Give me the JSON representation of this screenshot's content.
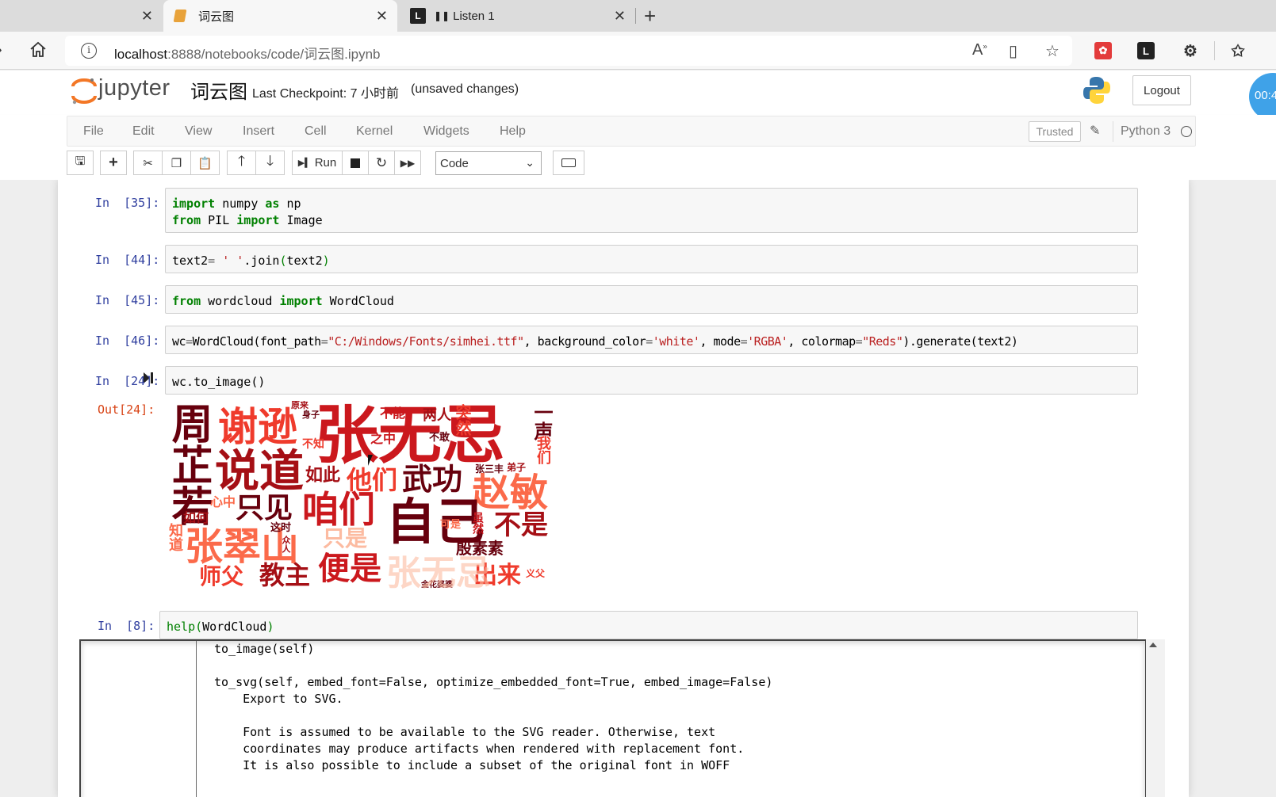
{
  "browser": {
    "tabs": [
      {
        "label": ""
      },
      {
        "label": "词云图"
      },
      {
        "label": "Listen 1"
      }
    ],
    "url_host": "localhost",
    "url_path": ":8888/notebooks/code/词云图.ipynb"
  },
  "jupyter": {
    "logo_text": "jupyter",
    "notebook_title": "词云图",
    "checkpoint": "Last Checkpoint: 7 小时前",
    "unsaved": "(unsaved changes)",
    "logout": "Logout",
    "timer": "00:4"
  },
  "menu": [
    "File",
    "Edit",
    "View",
    "Insert",
    "Cell",
    "Kernel",
    "Widgets",
    "Help"
  ],
  "kernel": {
    "trusted": "Trusted",
    "name": "Python 3"
  },
  "toolbar": {
    "run_label": "Run",
    "cell_type": "Code"
  },
  "cells": [
    {
      "prompt": "In  [35]:",
      "lines": [
        "import numpy as np",
        "from PIL import Image"
      ]
    },
    {
      "prompt": "In  [44]:",
      "lines": [
        "text2= ' '.join(text2)"
      ]
    },
    {
      "prompt": "In  [45]:",
      "lines": [
        "from wordcloud import WordCloud"
      ]
    },
    {
      "prompt": "In  [46]:",
      "lines": [
        "wc=WordCloud(font_path=\"C:/Windows/Fonts/simhei.ttf\", background_color='white', mode='RGBA', colormap=\"Reds\").generate(text2)"
      ]
    },
    {
      "prompt": "In  [24]:",
      "lines": [
        "wc.to_image()"
      ]
    },
    {
      "prompt": "In  [8]:",
      "lines": [
        "help(WordCloud)"
      ]
    }
  ],
  "output_prompt": "Out[24]:",
  "wordcloud": {
    "words": [
      "张无忌",
      "谢逊",
      "说道",
      "周芷若",
      "赵敏",
      "自己",
      "咱们",
      "他们",
      "武功",
      "只见",
      "张翠山",
      "便是",
      "教主",
      "师父",
      "出来",
      "不是",
      "殷素素",
      "如此",
      "不能",
      "两人",
      "突然",
      "一声",
      "我们",
      "之中",
      "不知",
      "心中",
      "如何",
      "知道",
      "只是",
      "这时",
      "弟子",
      "张三丰",
      "身子",
      "原来",
      "义父",
      "金花婆婆",
      "不敢",
      "虽然",
      "可是",
      "众人"
    ],
    "colors": {
      "dark": "#67000d",
      "mid": "#a50f15",
      "red": "#cb181d",
      "light": "#ef3b2c",
      "pale": "#fb6a4a",
      "faint": "#fcbba1"
    }
  },
  "help_lines": [
    "to_image(self)",
    "",
    "to_svg(self, embed_font=False, optimize_embedded_font=True, embed_image=False)",
    "    Export to SVG.",
    "",
    "    Font is assumed to be available to the SVG reader. Otherwise, text",
    "    coordinates may produce artifacts when rendered with replacement font.",
    "    It is also possible to include a subset of the original font in WOFF"
  ]
}
